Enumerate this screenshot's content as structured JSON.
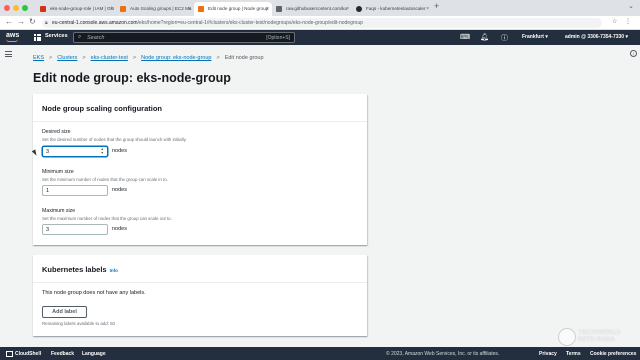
{
  "browser": {
    "tabs": [
      {
        "title": "eks-node-group-role | IAM | Glo",
        "favicon_color": "#d13212"
      },
      {
        "title": "Auto Scaling groups | EC2 Ma",
        "favicon_color": "#ec7211"
      },
      {
        "title": "Edit node group | Node group",
        "favicon_color": "#ec7211"
      },
      {
        "title": "raw.githubusercontent.com/ku",
        "favicon_color": "#5f6368"
      },
      {
        "title": "Faqs - kubernetes/autoscaler",
        "favicon_color": "#24292f"
      }
    ],
    "active_tab_index": 2,
    "new_tab": "+",
    "url_host": "eu-central-1.console.aws.amazon.com",
    "url_path": "/eks/home?region=eu-central-1#/clusters/eks-cluster-test/nodegroups/eks-node-group/edit-nodegroup"
  },
  "aws_header": {
    "logo": "aws",
    "services_label": "Services",
    "search_placeholder": "Search",
    "search_shortcut": "[Option+S]",
    "region": "Frankfurt ▾",
    "account": "admin @ 3306-7354-7330 ▾"
  },
  "breadcrumb": {
    "items": [
      "EKS",
      "Clusters",
      "eks-cluster-test",
      "Node group: eks-node-group"
    ],
    "current": "Edit node group",
    "separator": ">"
  },
  "page_title": "Edit node group: eks-node-group",
  "scaling_panel": {
    "title": "Node group scaling configuration",
    "fields": [
      {
        "label": "Desired size",
        "description": "Set the desired number of nodes that the group should launch with initially.",
        "value": "3",
        "unit": "nodes",
        "focused": true
      },
      {
        "label": "Minimum size",
        "description": "Set the minimum number of nodes that the group can scale in to.",
        "value": "1",
        "unit": "nodes",
        "focused": false
      },
      {
        "label": "Maximum size",
        "description": "Set the maximum number of nodes that the group can scale out to.",
        "value": "3",
        "unit": "nodes",
        "focused": false
      }
    ]
  },
  "labels_panel": {
    "title": "Kubernetes labels",
    "info": "Info",
    "empty_message": "This node group does not have any labels.",
    "add_button": "Add label",
    "remaining": "Remaining labels available to add: 50"
  },
  "footer": {
    "cloudshell": "CloudShell",
    "feedback": "Feedback",
    "language": "Language",
    "copyright": "© 2023, Amazon Web Services, Inc. or its affiliates.",
    "privacy": "Privacy",
    "terms": "Terms",
    "cookies": "Cookie preferences"
  },
  "watermark": {
    "line1": "TECHWORLD",
    "line2": "WITH NANA"
  },
  "colors": {
    "aws_nav": "#232f3e",
    "link": "#0073bb",
    "aws_orange": "#ff9900",
    "page_bg": "#f2f3f3"
  }
}
